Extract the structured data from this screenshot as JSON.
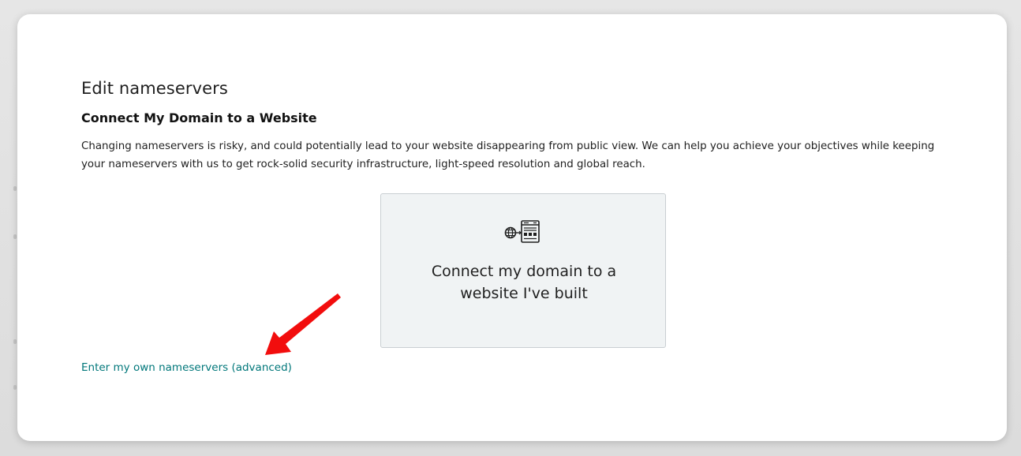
{
  "modal": {
    "close_label": ":",
    "heading": "Edit nameservers",
    "subheading": "Connect My Domain to a Website",
    "description": "Changing nameservers is risky, and could potentially lead to your website disappearing from public view. We can help you achieve your objectives while keeping your nameservers with us to get rock-solid security infrastructure, light-speed resolution and global reach.",
    "card": {
      "icon": "globe-to-website-icon",
      "label": "Connect my domain to a website I've built"
    },
    "advanced_link": "Enter my own nameservers (advanced)"
  },
  "annotation": {
    "arrow_color": "#f20d0d",
    "arrow_icon": "red-arrow-pointer"
  },
  "colors": {
    "link": "#00777a",
    "card_bg": "#f0f3f4",
    "text": "#1f1f1f"
  }
}
